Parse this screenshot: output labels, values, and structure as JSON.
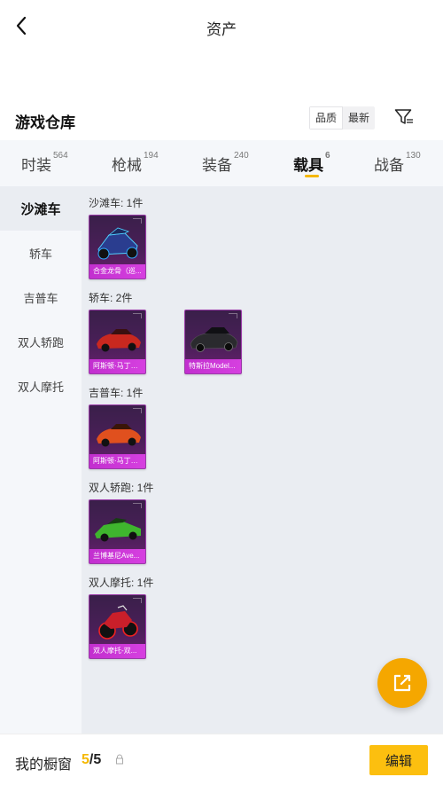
{
  "header": {
    "title": "资产",
    "back_icon": "chevron-left-icon"
  },
  "warehouse": {
    "title": "游戏仓库",
    "sort_options": [
      "品质",
      "最新"
    ],
    "sort_active": "品质",
    "filter_icon": "filter-icon"
  },
  "tabs": [
    {
      "label": "时装",
      "count": "564"
    },
    {
      "label": "枪械",
      "count": "194"
    },
    {
      "label": "装备",
      "count": "240"
    },
    {
      "label": "载具",
      "count": "6"
    },
    {
      "label": "战备",
      "count": "130"
    }
  ],
  "active_tab": "载具",
  "sidebar": {
    "items": [
      "沙滩车",
      "轿车",
      "吉普车",
      "双人轿跑",
      "双人摩托"
    ],
    "active": "沙滩车"
  },
  "groups": [
    {
      "title": "沙滩车: 1件",
      "items": [
        {
          "name": "合金龙骨（巡..."
        }
      ]
    },
    {
      "title": "轿车: 2件",
      "items": [
        {
          "name": "阿斯顿·马丁D..."
        },
        {
          "name": "特斯拉Model..."
        }
      ]
    },
    {
      "title": "吉普车: 1件",
      "items": [
        {
          "name": "阿斯顿·马丁D..."
        }
      ]
    },
    {
      "title": "双人轿跑: 1件",
      "items": [
        {
          "name": "兰博基尼Ave..."
        }
      ]
    },
    {
      "title": "双人摩托: 1件",
      "items": [
        {
          "name": "双人摩托-双..."
        }
      ]
    }
  ],
  "fab": {
    "icon": "share-out-icon"
  },
  "bottom": {
    "label": "我的橱窗",
    "current": "5",
    "separator": "/",
    "total": "5",
    "lock_icon": "lock-icon",
    "edit_label": "编辑"
  },
  "colors": {
    "accent": "#fcbf0f",
    "card_purple": "#4a1f58",
    "card_label": "#c22fcf"
  }
}
